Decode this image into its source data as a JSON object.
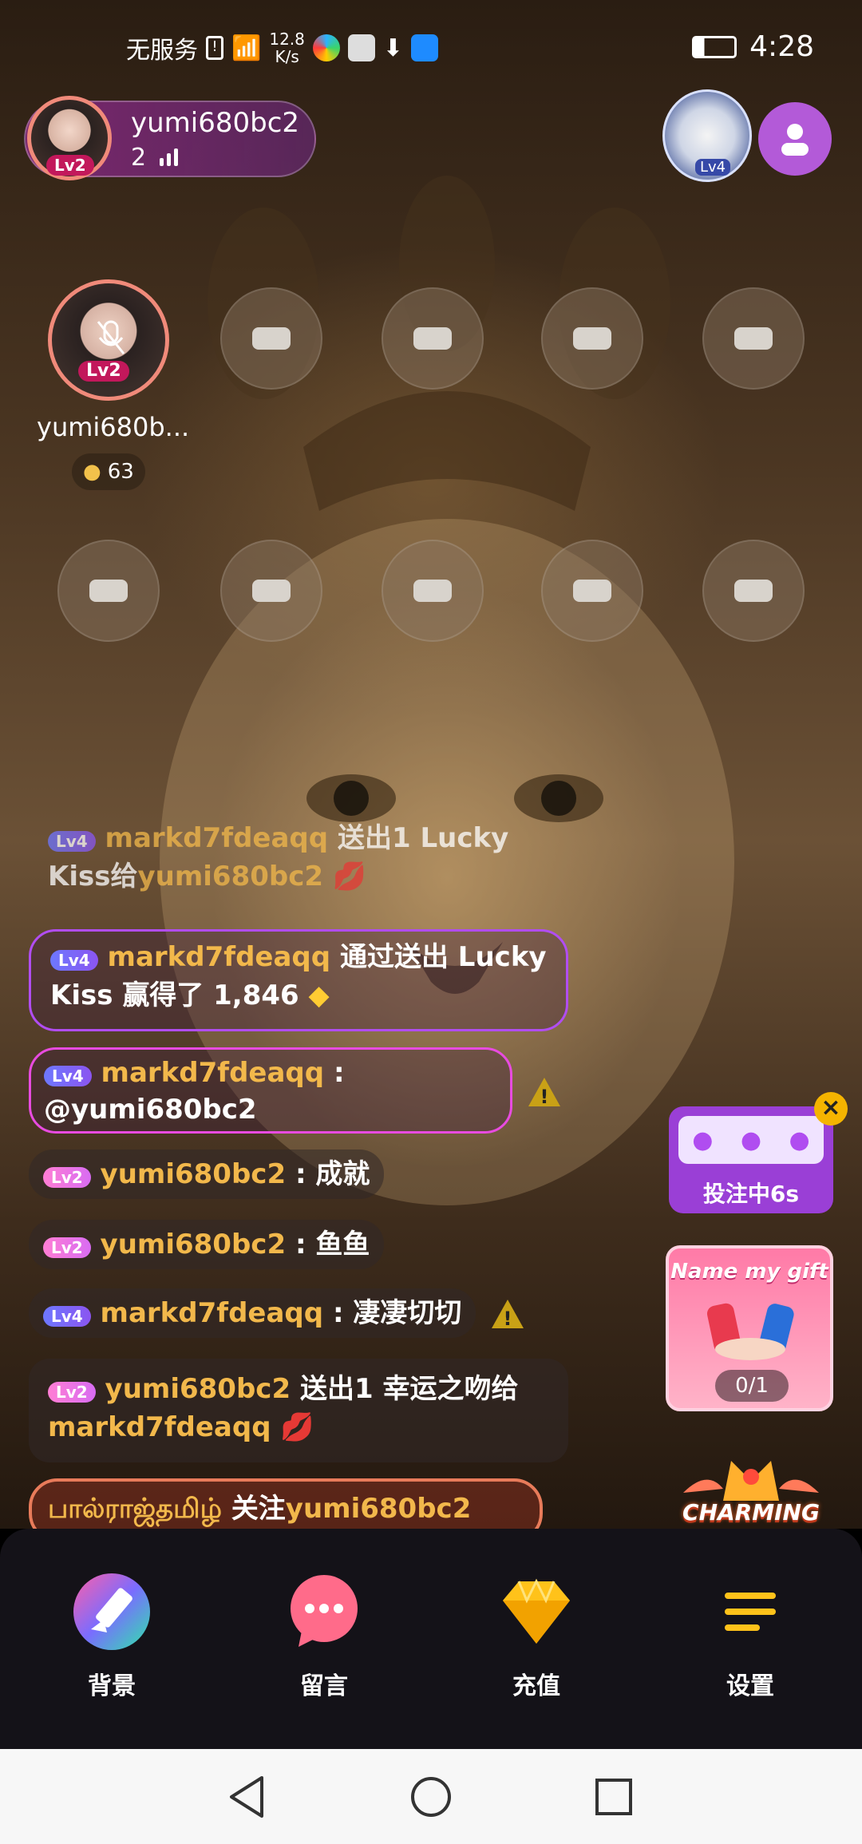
{
  "status_bar": {
    "carrier": "无服务",
    "net_speed_value": "12.8",
    "net_speed_unit": "K/s",
    "time": "4:28"
  },
  "host": {
    "name": "yumi680bc2",
    "level": "Lv2",
    "viewer_count": "2"
  },
  "badge_level": "Lv4",
  "seats": {
    "occupied": {
      "name": "yumi680b...",
      "level": "Lv2",
      "coins": "63"
    }
  },
  "chat": [
    {
      "level": "Lv4",
      "user": "markd7fdeaqq",
      "text1": "送出1 Lucky",
      "text2": "Kiss给",
      "target": "yumi680bc2"
    },
    {
      "level": "Lv4",
      "user": "markd7fdeaqq",
      "text1": "通过送出 Lucky",
      "text2": "Kiss 赢得了 1,846"
    },
    {
      "level": "Lv4",
      "user": "markd7fdeaqq",
      "sep": " :",
      "text2": "@yumi680bc2"
    },
    {
      "level": "Lv2",
      "user": "yumi680bc2",
      "text": " : 成就"
    },
    {
      "level": "Lv2",
      "user": "yumi680bc2",
      "text": " : 鱼鱼"
    },
    {
      "level": "Lv4",
      "user": "markd7fdeaqq",
      "text": " : 凄凄切切"
    },
    {
      "level": "Lv2",
      "user": "yumi680bc2",
      "text1": "送出1 幸运之吻给",
      "target": "markd7fdeaqq"
    },
    {
      "tamil": "பால்ராஜ்தமிழ்",
      "text1": "关注",
      "target": "yumi680bc2"
    }
  ],
  "widgets": {
    "bet_label": "投注中6s",
    "close": "×",
    "name_gift_title": "Name my gift",
    "name_gift_count": "0/1",
    "charming": "CHARMING"
  },
  "bottom_bar": {
    "items": [
      {
        "label": "背景",
        "icon": "brush-icon"
      },
      {
        "label": "留言",
        "icon": "message-icon"
      },
      {
        "label": "充值",
        "icon": "diamond-icon"
      },
      {
        "label": "设置",
        "icon": "menu-icon"
      }
    ]
  },
  "colors": {
    "username": "#f2b84b",
    "lv4_badge": "#6d78ff",
    "lv2_badge": "#ff7ed4",
    "accent_purple": "#b35ad8"
  }
}
